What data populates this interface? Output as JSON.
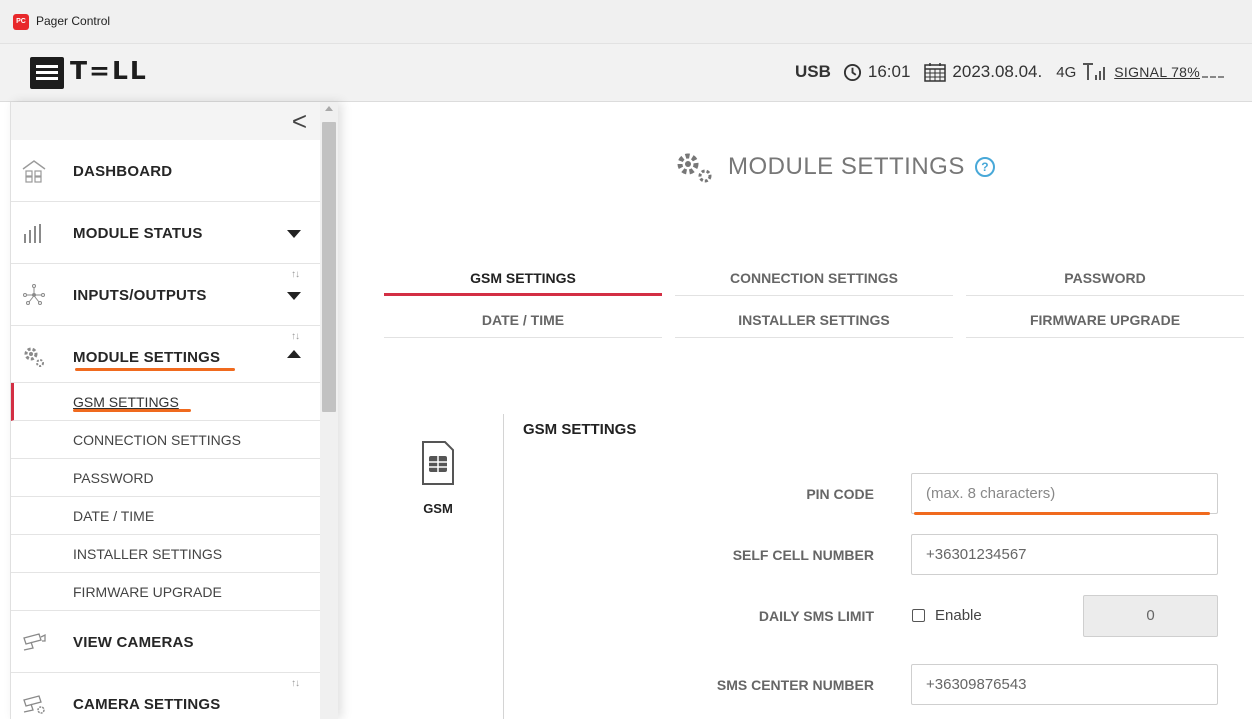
{
  "window": {
    "title": "Pager Control",
    "icon_text": "PC"
  },
  "header": {
    "logo": "T=LL",
    "connection": "USB",
    "time": "16:01",
    "date": "2023.08.04.",
    "network": "4G",
    "signal": "SIGNAL 78%"
  },
  "sidebar": {
    "collapse": "<",
    "dashboard": "DASHBOARD",
    "module_status": "MODULE STATUS",
    "inputs_outputs": "INPUTS/OUTPUTS",
    "module_settings": "MODULE SETTINGS",
    "sub_items": [
      "GSM SETTINGS",
      "CONNECTION SETTINGS",
      "PASSWORD",
      "DATE / TIME",
      "INSTALLER SETTINGS",
      "FIRMWARE UPGRADE"
    ],
    "view_cameras": "VIEW CAMERAS",
    "camera_settings": "CAMERA SETTINGS",
    "sort_glyph": "↑↓"
  },
  "main": {
    "title": "MODULE SETTINGS",
    "help": "?",
    "tabs": [
      "GSM SETTINGS",
      "CONNECTION SETTINGS",
      "PASSWORD",
      "DATE / TIME",
      "INSTALLER SETTINGS",
      "FIRMWARE UPGRADE"
    ],
    "card_label": "GSM",
    "section_title": "GSM SETTINGS",
    "form": {
      "pin_label": "PIN CODE",
      "pin_placeholder": "(max. 8 characters)",
      "self_cell_label": "SELF CELL NUMBER",
      "self_cell_value": "+36301234567",
      "daily_sms_label": "DAILY SMS LIMIT",
      "enable_label": "Enable",
      "daily_sms_value": "0",
      "sms_center_label": "SMS CENTER NUMBER",
      "sms_center_value": "+36309876543"
    }
  },
  "colors": {
    "accent": "#d32f44",
    "highlight": "#f06a1e",
    "help": "#48a8d8"
  }
}
